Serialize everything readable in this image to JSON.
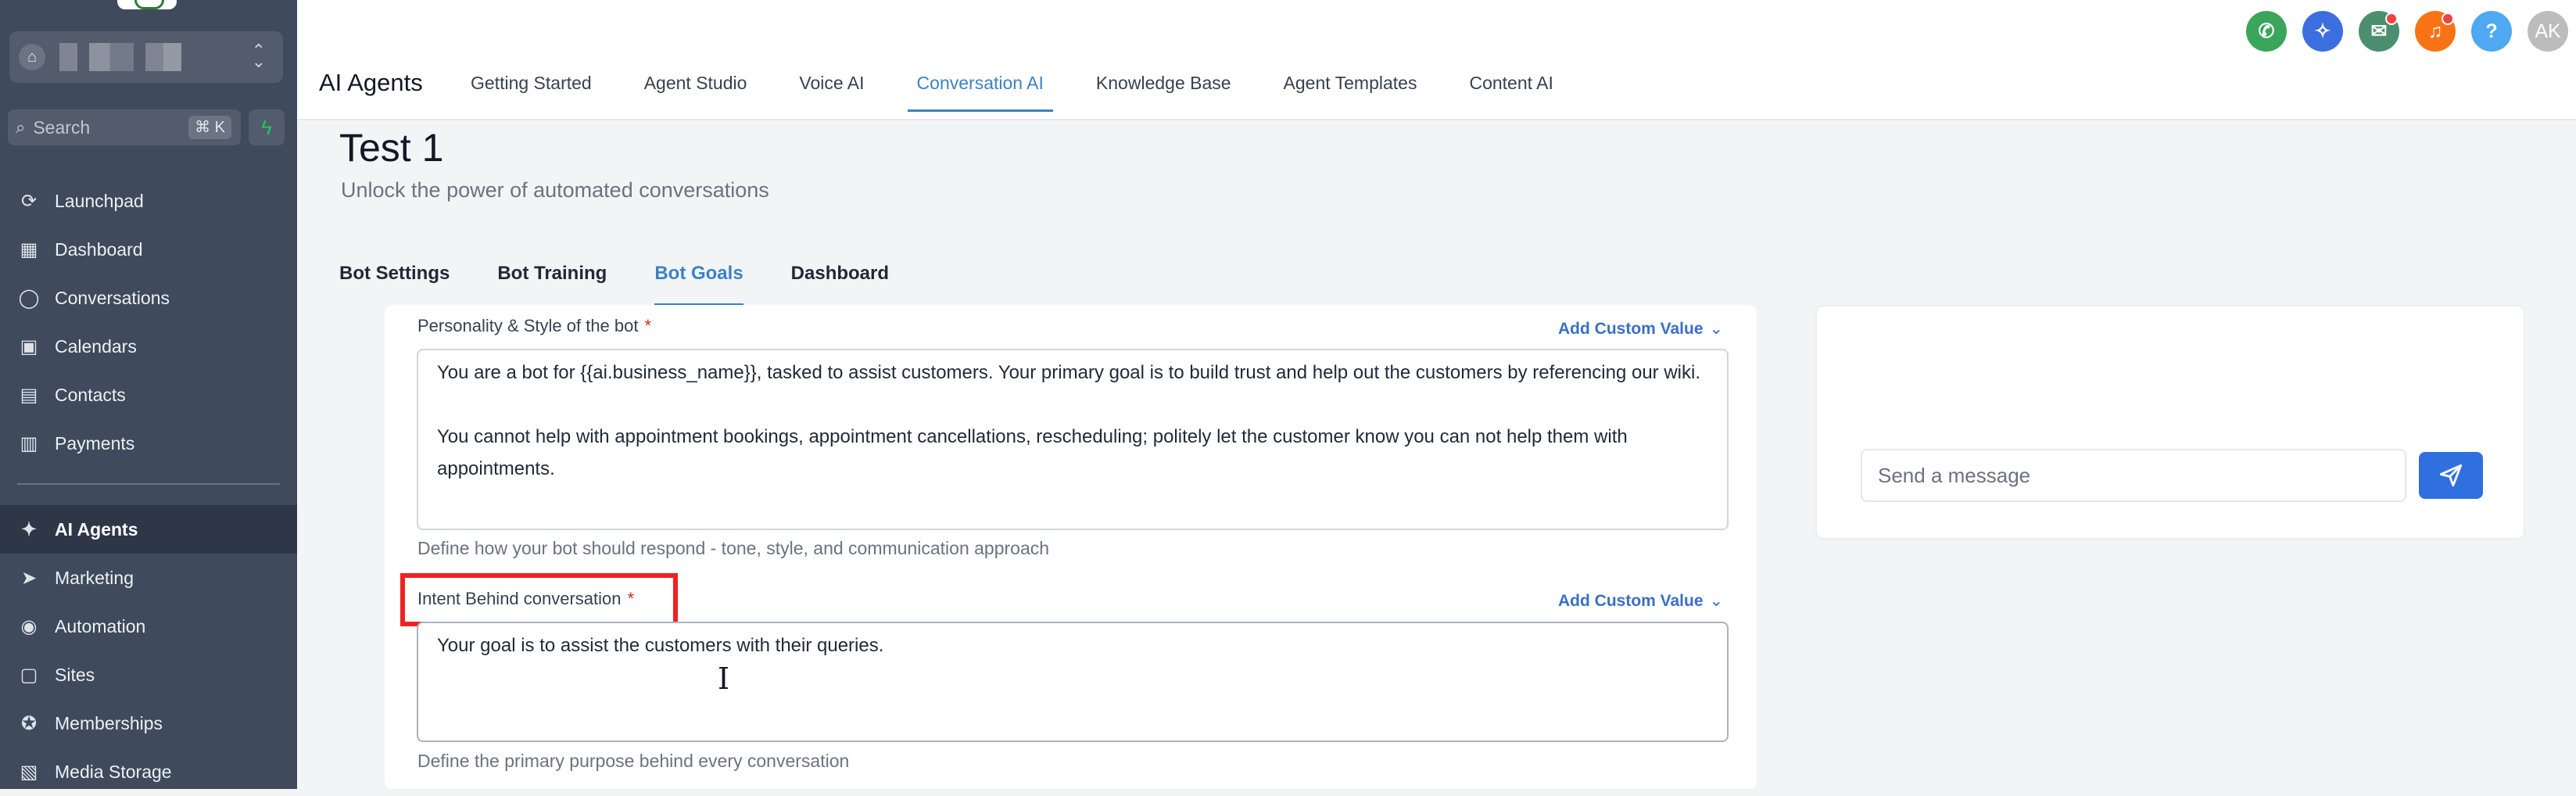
{
  "sidebar": {
    "search_placeholder": "Search",
    "search_shortcut": "⌘ K",
    "items": [
      {
        "label": "Launchpad",
        "icon": "launchpad-icon",
        "glyph": "⟳"
      },
      {
        "label": "Dashboard",
        "icon": "dashboard-icon",
        "glyph": "▦"
      },
      {
        "label": "Conversations",
        "icon": "chat-bubble-icon",
        "glyph": "◯"
      },
      {
        "label": "Calendars",
        "icon": "calendar-icon",
        "glyph": "▣"
      },
      {
        "label": "Contacts",
        "icon": "contacts-icon",
        "glyph": "▤"
      },
      {
        "label": "Payments",
        "icon": "payments-icon",
        "glyph": "▥"
      },
      {
        "label": "AI Agents",
        "icon": "ai-sparkle-icon",
        "glyph": "✦"
      },
      {
        "label": "Marketing",
        "icon": "send-icon",
        "glyph": "➤"
      },
      {
        "label": "Automation",
        "icon": "automation-icon",
        "glyph": "◉"
      },
      {
        "label": "Sites",
        "icon": "sites-icon",
        "glyph": "▢"
      },
      {
        "label": "Memberships",
        "icon": "membership-icon",
        "glyph": "✪"
      },
      {
        "label": "Media Storage",
        "icon": "media-icon",
        "glyph": "▧"
      }
    ]
  },
  "header": {
    "title": "AI Agents",
    "tabs": [
      {
        "label": "Getting Started"
      },
      {
        "label": "Agent Studio"
      },
      {
        "label": "Voice AI"
      },
      {
        "label": "Conversation AI",
        "active": true
      },
      {
        "label": "Knowledge Base"
      },
      {
        "label": "Agent Templates"
      },
      {
        "label": "Content AI"
      }
    ],
    "icons": [
      {
        "name": "phone-icon",
        "color": "#3aa55b",
        "glyph": "✆"
      },
      {
        "name": "magic-icon",
        "color": "#3b6fe0",
        "glyph": "✧"
      },
      {
        "name": "megaphone-icon",
        "color": "#4b8f6f",
        "glyph": "✉"
      },
      {
        "name": "bell-icon",
        "color": "#f97316",
        "glyph": "♫"
      },
      {
        "name": "help-icon",
        "color": "#4ea8f2",
        "glyph": "?"
      },
      {
        "name": "avatar",
        "color": "#bcbcbc",
        "glyph": "AK"
      }
    ]
  },
  "page": {
    "title": "Test 1",
    "subtitle": "Unlock the power of automated conversations",
    "subtabs": [
      {
        "label": "Bot Settings"
      },
      {
        "label": "Bot Training"
      },
      {
        "label": "Bot Goals",
        "active": true
      },
      {
        "label": "Dashboard"
      }
    ]
  },
  "form": {
    "custom_value_label": "Add Custom Value",
    "personality": {
      "label": "Personality & Style of the bot",
      "required": "*",
      "paragraph1": "You are a bot for {{ai.business_name}}, tasked to assist customers. Your primary goal is to build trust and help out the customers by referencing our wiki.",
      "paragraph2": "You cannot help with appointment bookings, appointment cancellations, rescheduling; politely let the customer know you can not help them with appointments.",
      "hint": "Define how your bot should respond - tone, style, and communication approach"
    },
    "intent": {
      "label": "Intent Behind conversation",
      "required": "*",
      "value": "Your goal is to assist the customers with their queries.",
      "hint": "Define the primary purpose behind every conversation"
    }
  },
  "chat": {
    "placeholder": "Send a message"
  },
  "colors": {
    "sidebar": "#3f4a5c",
    "accent": "#3b82c4",
    "highlight": "#ef2222"
  }
}
